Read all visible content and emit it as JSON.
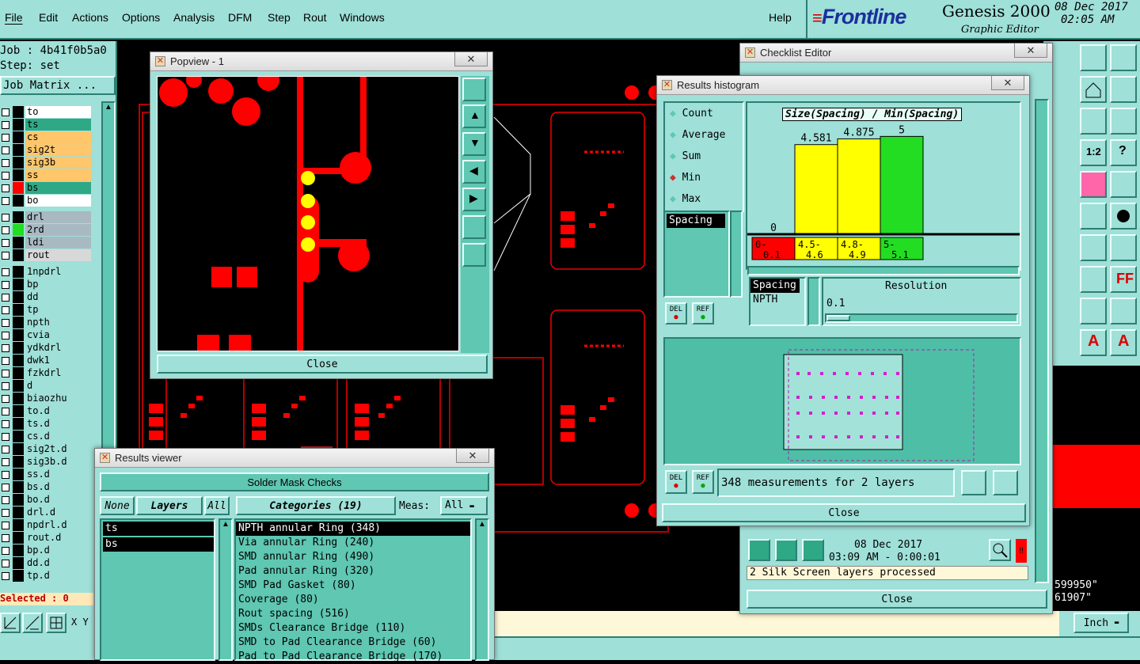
{
  "menu": [
    "File",
    "Edit",
    "Actions",
    "Options",
    "Analysis",
    "DFM",
    "Step",
    "Rout",
    "Windows"
  ],
  "help": "Help",
  "brand": {
    "logo": "Frontline",
    "product": "Genesis 2000",
    "subtitle": "Graphic Editor",
    "date": "08 Dec 2017",
    "time": "02:05 AM"
  },
  "job": {
    "job": "Job : 4b41f0b5a0",
    "step": "Step: set",
    "matrix_btn": "Job Matrix ..."
  },
  "layers_a": [
    {
      "name": "to",
      "color": "#ffffff"
    },
    {
      "name": "ts",
      "color": "#2fa886"
    },
    {
      "name": "cs",
      "color": "#ffc66b"
    },
    {
      "name": "sig2t",
      "color": "#ffc66b"
    },
    {
      "name": "sig3b",
      "color": "#ffc66b"
    },
    {
      "name": "ss",
      "color": "#ffc66b"
    },
    {
      "name": "bs",
      "color": "#2fa886"
    },
    {
      "name": "bo",
      "color": "#ffffff"
    }
  ],
  "layers_b": [
    {
      "name": "drl",
      "color": "#a9b9c2"
    },
    {
      "name": "2rd",
      "color": "#a9b9c2"
    },
    {
      "name": "ldi",
      "color": "#a9b9c2"
    },
    {
      "name": "rout",
      "color": "#d8d8d8"
    }
  ],
  "layers_c": [
    "1npdrl",
    "bp",
    "dd",
    "tp",
    "npth",
    "cvia",
    "ydkdrl",
    "dwk1",
    "fzkdrl",
    "d",
    "biaozhu",
    "to.d",
    "ts.d",
    "cs.d",
    "sig2t.d",
    "sig3b.d",
    "ss.d",
    "bs.d",
    "bo.d",
    "drl.d",
    "npdrl.d",
    "rout.d",
    "bp.d",
    "dd.d",
    "tp.d"
  ],
  "selected": "Selected : 0",
  "xy": "X Y",
  "units": "Inch",
  "coords": {
    "x": "599950\"",
    "y": "61907\""
  },
  "popview": {
    "title": "Popview - 1",
    "close": "Close"
  },
  "results_viewer": {
    "title": "Results viewer",
    "header": "Solder Mask Checks",
    "none": "None",
    "layers": "Layers",
    "all": "All",
    "categories": "Categories (19)",
    "meas_label": "Meas:",
    "meas_value": "All",
    "layer_list": [
      "ts",
      "bs"
    ],
    "cat_list": [
      "NPTH annular Ring (348)",
      "Via annular Ring (240)",
      "SMD annular Ring (490)",
      "Pad annular Ring (320)",
      "SMD Pad Gasket (80)",
      "Coverage (80)",
      "Rout spacing (516)",
      "SMDs Clearance Bridge (110)",
      "SMD to Pad Clearance Bridge (60)",
      "Pad to Pad Clearance Bridge (170)"
    ]
  },
  "checklist": {
    "title": "Checklist Editor",
    "date": "08 Dec 2017",
    "time": "03:09 AM - 0:00:01",
    "status": "2 Silk Screen layers processed",
    "close": "Close"
  },
  "histogram": {
    "title": "Results histogram",
    "modes": [
      "Count",
      "Average",
      "Sum",
      "Min",
      "Max"
    ],
    "selected_mode": "Min",
    "chart_title": "Size(Spacing) / Min(Spacing)",
    "measure_list": [
      "Spacing"
    ],
    "del": "DEL",
    "ref": "REF",
    "attr": [
      "Spacing",
      "NPTH"
    ],
    "resolution_label": "Resolution",
    "resolution_value": "0.1",
    "measurements": "348 measurements for 2 layers",
    "close": "Close"
  },
  "chart_data": {
    "type": "bar",
    "title": "Size(Spacing) / Min(Spacing)",
    "categories": [
      "0-0.1",
      "4.5-4.6",
      "4.8-4.9",
      "5-5.1"
    ],
    "values": [
      0,
      4.581,
      4.875,
      5
    ],
    "value_labels": [
      "0",
      "4.581",
      "4.875",
      "5"
    ],
    "colors": [
      "#ff0000",
      "#ffff00",
      "#ffff00",
      "#22dd22"
    ],
    "ylim": [
      0,
      5.5
    ]
  }
}
